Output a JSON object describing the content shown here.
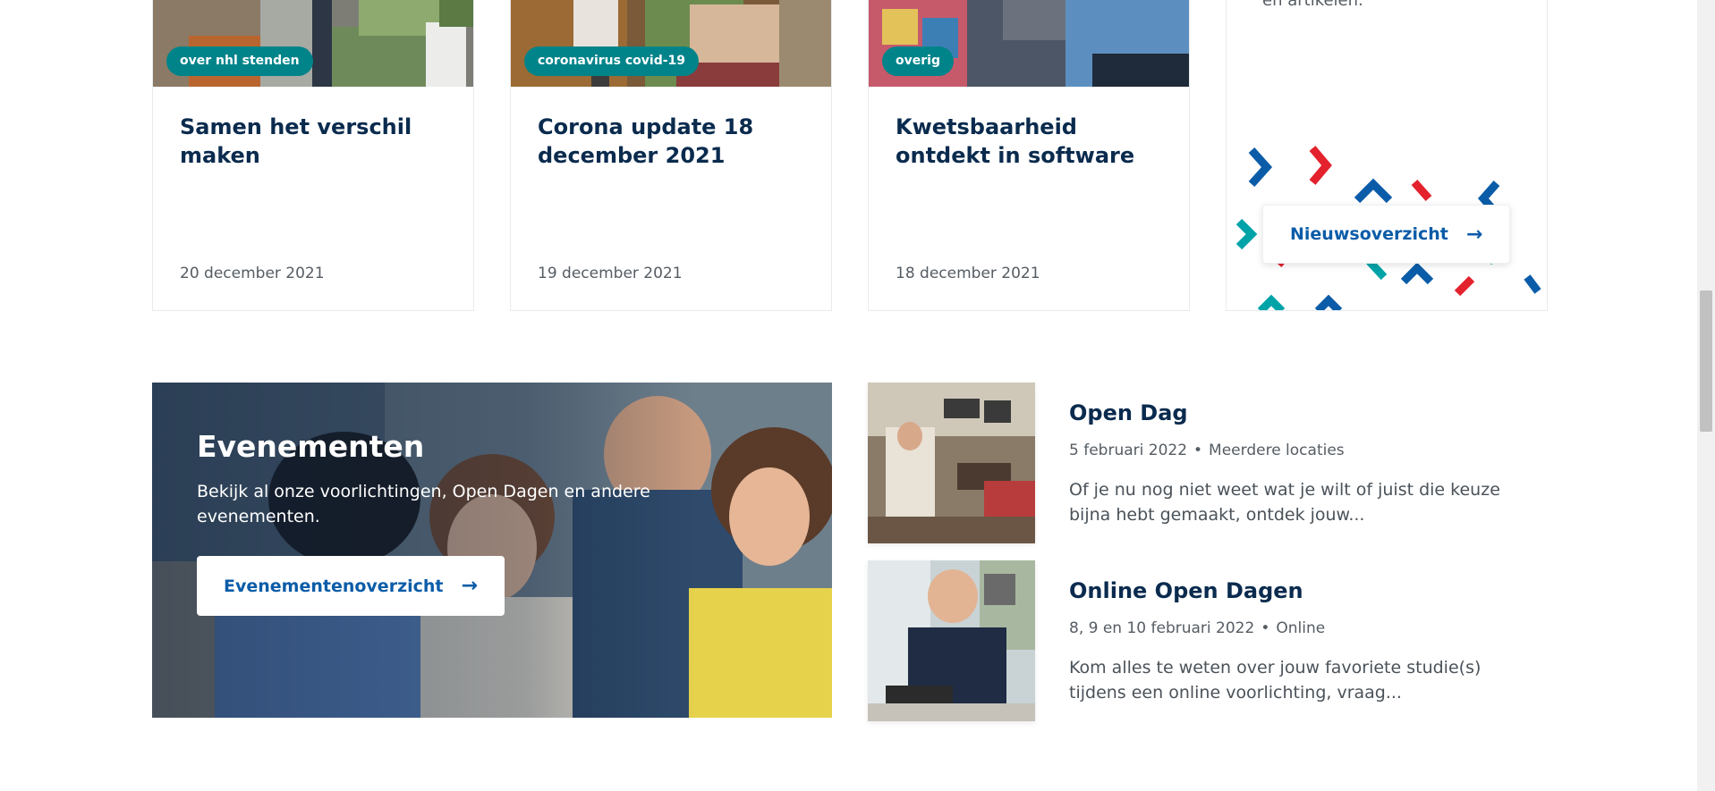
{
  "news": [
    {
      "tag": "over nhl stenden",
      "title": "Samen het verschil maken",
      "date": "20 december 2021"
    },
    {
      "tag": "coronavirus covid-19",
      "title": "Corona update 18 december 2021",
      "date": "19 december 2021"
    },
    {
      "tag": "overig",
      "title": "Kwetsbaarheid ontdekt in software",
      "date": "18 december 2021"
    }
  ],
  "overview": {
    "cut_text": "en artikelen.",
    "button_label": "Nieuwsoverzicht",
    "arrow": "→"
  },
  "events_hero": {
    "title": "Evenementen",
    "text": "Bekijk al onze voorlichtingen, Open Dagen en andere evenementen.",
    "button_label": "Evenementenoverzicht",
    "arrow": "→"
  },
  "events": [
    {
      "title": "Open Dag",
      "date": "5 februari 2022",
      "separator": "•",
      "location": "Meerdere locaties",
      "desc": "Of je nu nog niet weet wat je wilt of juist die keuze bijna hebt gemaakt, ontdek jouw..."
    },
    {
      "title": "Online Open Dagen",
      "date": "8, 9 en 10 februari 2022",
      "separator": "•",
      "location": "Online",
      "desc": "Kom alles te weten over jouw favoriete studie(s) tijdens een online voorlichting, vraag..."
    }
  ],
  "colors": {
    "brand_navy": "#0a2b4e",
    "link_blue": "#0b5ca8",
    "tag_teal": "#00848a",
    "pattern_red": "#e3222d",
    "pattern_blue": "#0b5ca8",
    "pattern_teal": "#00a3a8"
  },
  "icons": {
    "arrow": "arrow-right-icon"
  }
}
